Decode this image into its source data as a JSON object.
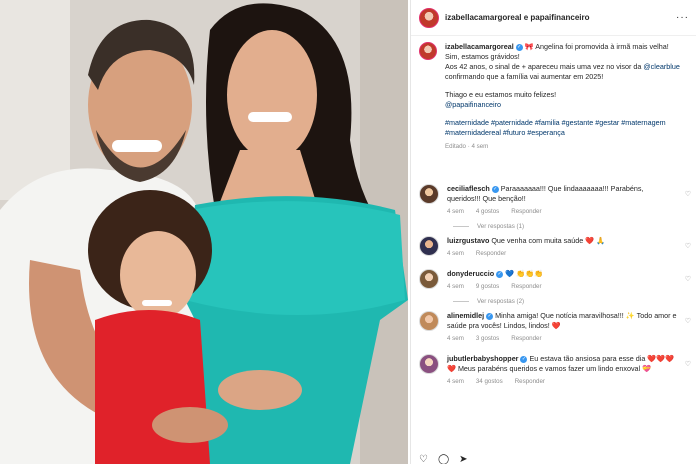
{
  "header": {
    "title": "izabellacamargoreal e papaifinanceiro",
    "more": "···"
  },
  "caption": {
    "username": "izabellacamargoreal",
    "verified": "✓",
    "line1": "🎀 Angelina foi promovida à irmã mais velha!",
    "line2": "Sim, estamos grávidos!",
    "line3_pre": "Aos 42 anos, o sinal de + apareceu mais uma vez no visor da",
    "line3_link": "@clearblue",
    "line3_post": "confirmando que a família vai aumentar em 2025!",
    "line4": "Thiago e eu estamos muito felizes!",
    "line4_link": "@papaifinanceiro",
    "hashtags": "#maternidade #paternidade #familia #gestante #gestar #maternagem #maternidadereal #futuro #esperança",
    "meta": "Editado · 4 sem"
  },
  "comments": [
    {
      "username": "ceciliaflesch",
      "verified": "✓",
      "text": "Paraaaaaaa!!! Que lindaaaaaaa!!! Parabéns, queridos!!! Que benção!!",
      "time": "4 sem",
      "likes": "4 gostos",
      "reply": "Responder",
      "view_replies": "Ver respostas (1)"
    },
    {
      "username": "luizrgustavo",
      "verified": "",
      "text": "Que venha com muita saúde ❤️ 🙏",
      "time": "4 sem",
      "likes": "",
      "reply": "Responder",
      "view_replies": ""
    },
    {
      "username": "donyderuccio",
      "verified": "✓",
      "text": "💙 👏👏👏",
      "time": "4 sem",
      "likes": "9 gostos",
      "reply": "Responder",
      "view_replies": "Ver respostas (2)"
    },
    {
      "username": "alinemidlej",
      "verified": "✓",
      "text": "Minha amiga! Que notícia maravilhosa!!! ✨ Todo amor e saúde pra vocês! Lindos, lindos! ❤️",
      "time": "4 sem",
      "likes": "3 gostos",
      "reply": "Responder",
      "view_replies": ""
    },
    {
      "username": "jubutlerbabyshopper",
      "verified": "✓",
      "text": "Eu estava tão ansiosa para esse dia ❤️❤️❤️❤️ Meus parabéns queridos e vamos fazer um lindo enxoval 💝",
      "time": "4 sem",
      "likes": "34 gostos",
      "reply": "Responder",
      "view_replies": ""
    }
  ],
  "icons": {
    "heart": "♡",
    "comment": "◯",
    "share": "➤"
  }
}
